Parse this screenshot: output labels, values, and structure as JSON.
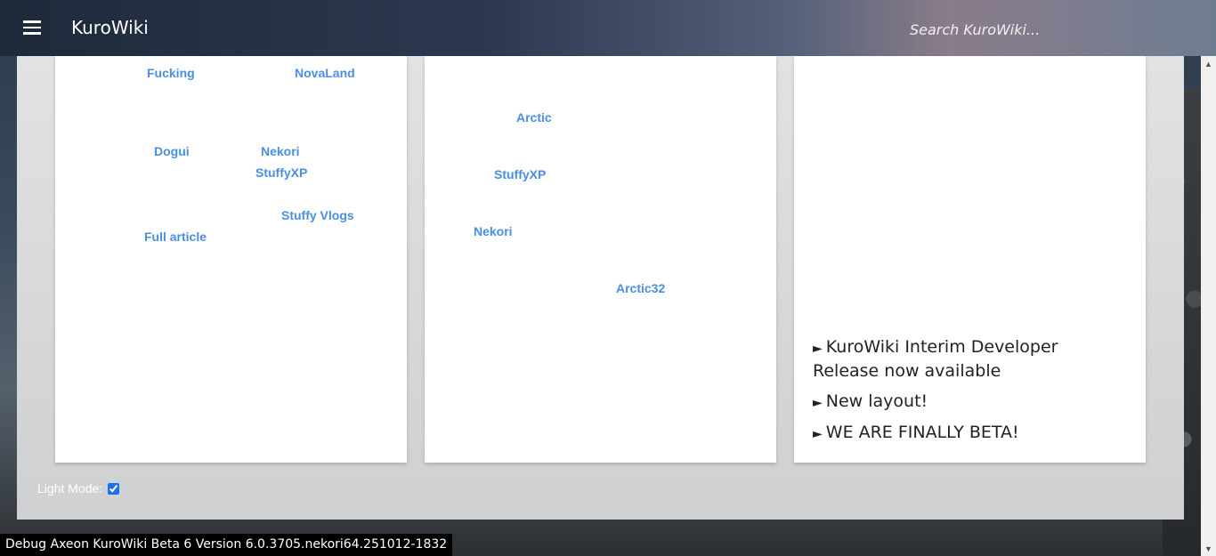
{
  "app": {
    "title": "KuroWiki"
  },
  "search": {
    "placeholder": "Search KuroWiki..."
  },
  "card1": {
    "links": [
      "Fucking",
      "NovaLand",
      "Dogui",
      "Nekori",
      "StuffyXP",
      "Stuffy Vlogs",
      "Full article"
    ]
  },
  "card2": {
    "links": [
      "Arctic",
      "StuffyXP",
      "Nekori",
      "Arctic32"
    ]
  },
  "card3": {
    "news": [
      "KuroWiki Interim Developer Release now available",
      "New layout!",
      "WE ARE FINALLY BETA!"
    ],
    "bullet": "►"
  },
  "settings": {
    "light_mode_label": "Light Mode:",
    "light_mode_checked": true
  },
  "debug": {
    "text": "Debug Axeon KuroWiki Beta 6 Version 6.0.3705.nekori64.251012-1832"
  },
  "colors": {
    "link": "#4a8ee3",
    "checkbox_accent": "#1a73e8"
  }
}
